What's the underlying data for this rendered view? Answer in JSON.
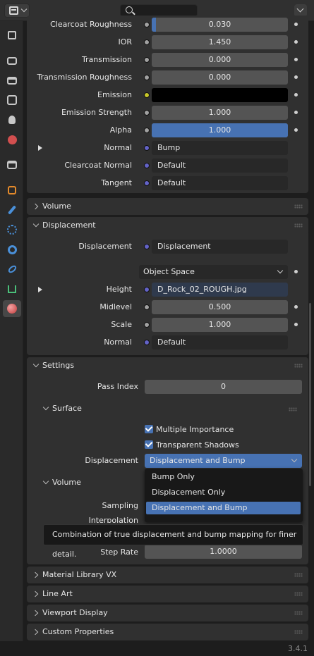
{
  "sidebar": {
    "tabs": [
      {
        "name": "tool-icon",
        "color": "#c8c8c8"
      },
      {
        "name": "render-icon",
        "color": "#c8c8c8"
      },
      {
        "name": "output-icon",
        "color": "#c8c8c8"
      },
      {
        "name": "view-layer-icon",
        "color": "#c8c8c8"
      },
      {
        "name": "scene-icon",
        "color": "#c8c8c8"
      },
      {
        "name": "world-icon",
        "color": "#d24f4f"
      },
      {
        "name": "collection-icon",
        "color": "#c8c8c8"
      },
      {
        "name": "object-icon",
        "color": "#e48a2b"
      },
      {
        "name": "modifier-icon",
        "color": "#4a90d9"
      },
      {
        "name": "particles-icon",
        "color": "#4a90d9"
      },
      {
        "name": "physics-icon",
        "color": "#4a90d9"
      },
      {
        "name": "constraints-icon",
        "color": "#4a90d9"
      },
      {
        "name": "data-icon",
        "color": "#4ac07a"
      },
      {
        "name": "material-icon",
        "color": "#d65a5a"
      }
    ]
  },
  "surface_rows": [
    {
      "label": "Clearcoat Roughness",
      "value": "0.030",
      "fill": 0.03
    },
    {
      "label": "IOR",
      "value": "1.450"
    },
    {
      "label": "Transmission",
      "value": "0.000"
    },
    {
      "label": "Transmission Roughness",
      "value": "0.000"
    },
    {
      "label": "Emission",
      "value": ""
    },
    {
      "label": "Emission Strength",
      "value": "1.000"
    },
    {
      "label": "Alpha",
      "value": "1.000",
      "fill": 1.0
    },
    {
      "label": "Normal",
      "value": "Bump"
    },
    {
      "label": "Clearcoat Normal",
      "value": "Default"
    },
    {
      "label": "Tangent",
      "value": "Default"
    }
  ],
  "panels": {
    "volume": "Volume",
    "displacement": "Displacement",
    "settings": "Settings",
    "material_library": "Material Library VX",
    "line_art": "Line Art",
    "viewport_display": "Viewport Display",
    "custom_properties": "Custom Properties"
  },
  "displacement": {
    "label": "Displacement",
    "node": "Displacement",
    "space": "Object Space",
    "height_label": "Height",
    "height_value": "D_Rock_02_ROUGH.jpg",
    "midlevel_label": "Midlevel",
    "midlevel_value": "0.500",
    "scale_label": "Scale",
    "scale_value": "1.000",
    "normal_label": "Normal",
    "normal_value": "Default"
  },
  "settings": {
    "pass_index_label": "Pass Index",
    "pass_index_value": "0",
    "surface_label": "Surface",
    "multiple_importance": "Multiple Importance",
    "transparent_shadows": "Transparent Shadows",
    "displacement_label": "Displacement",
    "displacement_value": "Displacement and Bump",
    "volume_label": "Volume",
    "sampling_label": "Sampling",
    "interpolation_label": "Interpolation",
    "step_rate_label": "Step Rate",
    "step_rate_value": "1.0000"
  },
  "dropdown": {
    "options": [
      "Bump Only",
      "Displacement Only",
      "Displacement and Bump"
    ],
    "selected": "Displacement and Bump"
  },
  "tooltip": "Combination of true displacement and bump mapping for finer detail.",
  "version": "3.4.1",
  "colors": {
    "accent": "#4772b3",
    "emission": "#000000"
  }
}
